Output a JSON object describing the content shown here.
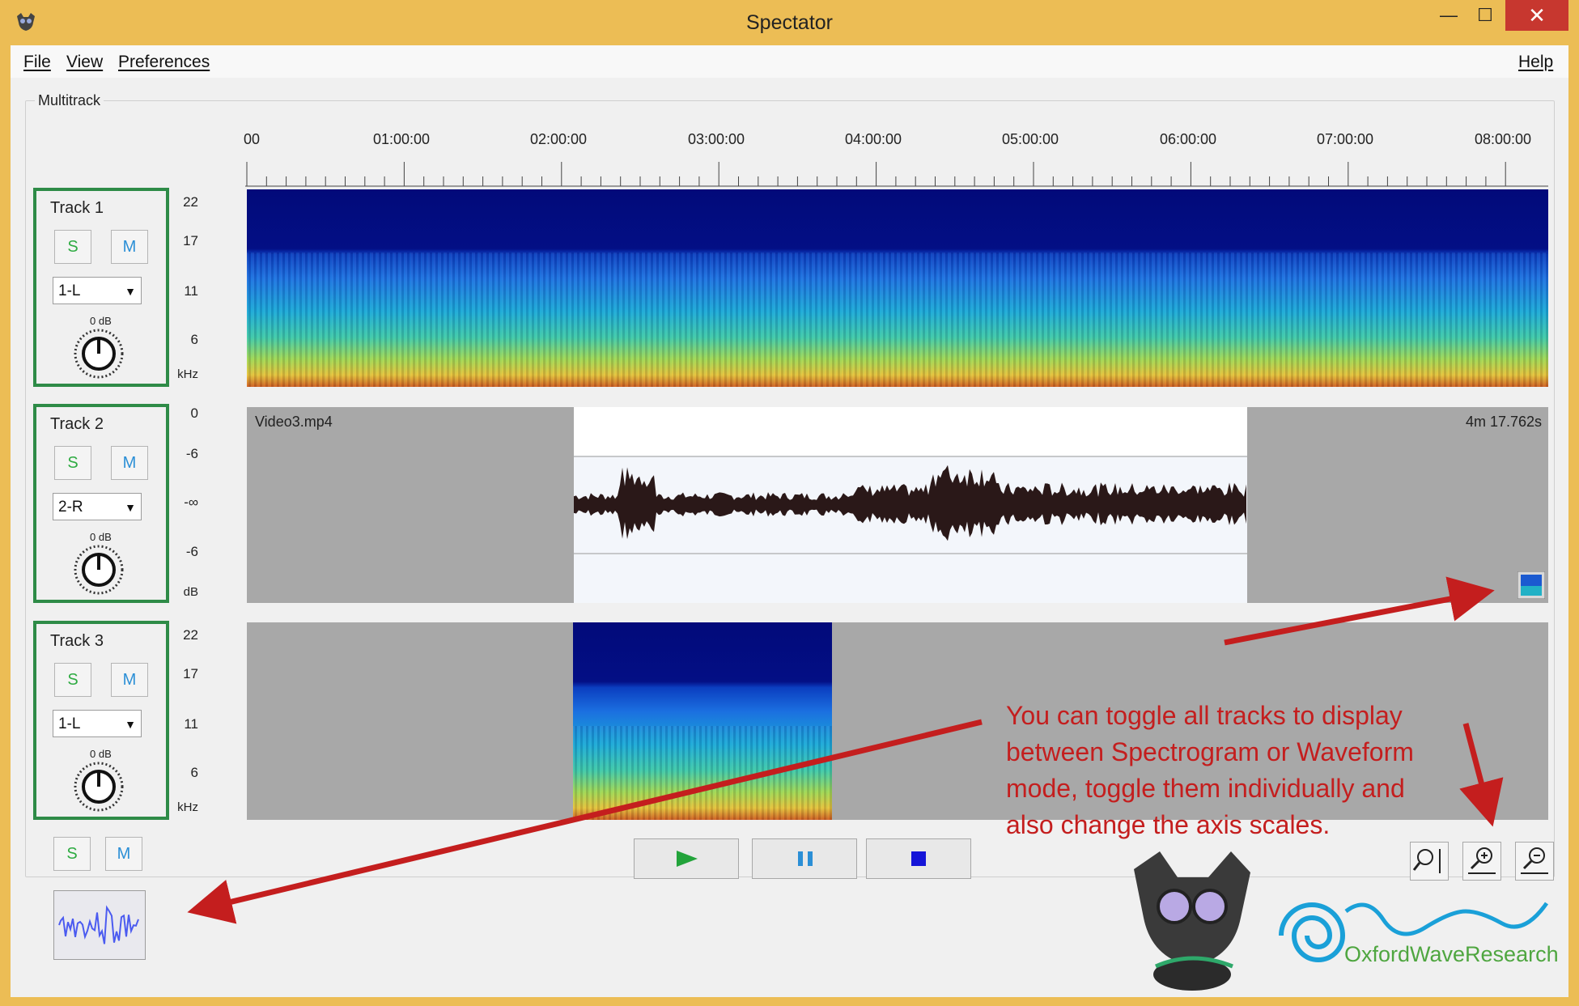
{
  "window": {
    "title": "Spectator"
  },
  "window_buttons": {
    "minimize": "—",
    "maximize": "☐",
    "close": "✕"
  },
  "menu": {
    "file": "File",
    "view": "View",
    "preferences": "Preferences",
    "help": "Help"
  },
  "group": {
    "label": "Multitrack"
  },
  "timeline": {
    "labels": [
      "00",
      "01:00:00",
      "02:00:00",
      "03:00:00",
      "04:00:00",
      "05:00:00",
      "06:00:00",
      "07:00:00",
      "08:00:00"
    ]
  },
  "tracks": [
    {
      "name": "Track 1",
      "solo": "S",
      "mute": "M",
      "channel": "1-L",
      "gain": "0 dB",
      "mode": "spectrogram",
      "y_ticks": [
        "22",
        "17",
        "11",
        "6",
        "kHz"
      ]
    },
    {
      "name": "Track 2",
      "solo": "S",
      "mute": "M",
      "channel": "2-R",
      "gain": "0 dB",
      "mode": "waveform",
      "y_ticks": [
        "0",
        "-6",
        "-∞",
        "-6",
        "dB"
      ],
      "file_label": "Video3.mp4",
      "duration_label": "4m 17.762s"
    },
    {
      "name": "Track 3",
      "solo": "S",
      "mute": "M",
      "channel": "1-L",
      "gain": "0 dB",
      "mode": "spectrogram",
      "y_ticks": [
        "22",
        "17",
        "11",
        "6",
        "kHz"
      ]
    }
  ],
  "global_controls": {
    "solo": "S",
    "mute": "M"
  },
  "callout": {
    "text": "You can toggle all tracks to display between Spectrogram or Waveform mode, toggle them individually and also change the axis scales."
  },
  "transport": {
    "play_icon": "play-icon",
    "pause_icon": "pause-icon",
    "stop_icon": "stop-icon"
  },
  "logo": {
    "text": "OxfordWaveResearch"
  },
  "colors": {
    "accent_green": "#2e8b47",
    "solo_green": "#2eab42",
    "mute_blue": "#2b8fd6",
    "callout_red": "#c41e1e",
    "title_bar": "#ecbd55"
  }
}
